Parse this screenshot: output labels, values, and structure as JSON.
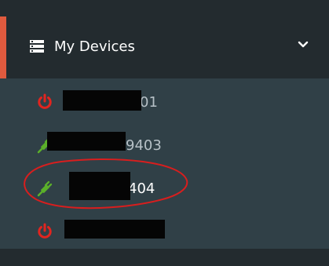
{
  "menu": {
    "title": "My Devices",
    "icons": {
      "header": "server-list-icon",
      "toggle": "chevron-down-icon"
    },
    "colors": {
      "accent": "#e05a3e",
      "offline": "#e2241f",
      "online": "#5bb02a",
      "header_bg": "#232b2f",
      "list_bg": "#304047"
    },
    "devices": [
      {
        "label": "01",
        "status": "offline",
        "icon": "power-icon"
      },
      {
        "label": "9403",
        "status": "online",
        "icon": "plug-icon"
      },
      {
        "label": "404",
        "status": "online",
        "icon": "plug-icon"
      },
      {
        "label": "",
        "status": "offline",
        "icon": "power-icon"
      }
    ]
  }
}
